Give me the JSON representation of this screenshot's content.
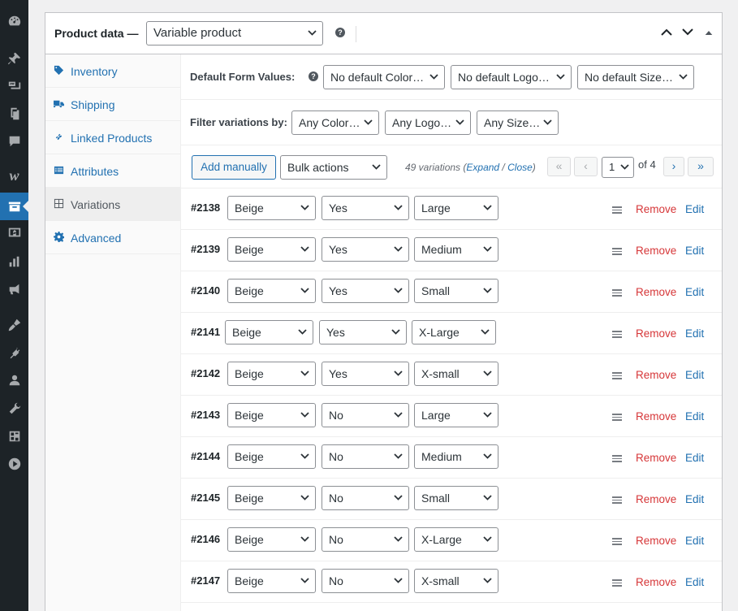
{
  "sidebar_icons": [
    "dashboard-icon",
    "pin-icon",
    "media-icon",
    "pages-icon",
    "comments-icon",
    "woocommerce-icon",
    "products-icon",
    "payments-icon",
    "analytics-icon",
    "marketing-icon",
    "appearance-icon",
    "plugins-icon",
    "users-icon",
    "tools-icon",
    "settings-icon",
    "collapse-icon"
  ],
  "header": {
    "title": "Product data —",
    "product_type": "Variable product",
    "help": "?"
  },
  "tabs": [
    {
      "label": "Inventory",
      "icon": "tag-icon"
    },
    {
      "label": "Shipping",
      "icon": "truck-icon"
    },
    {
      "label": "Linked Products",
      "icon": "link-icon"
    },
    {
      "label": "Attributes",
      "icon": "list-icon"
    },
    {
      "label": "Variations",
      "icon": "grid-icon",
      "active": true
    },
    {
      "label": "Advanced",
      "icon": "gear-icon"
    }
  ],
  "defaults": {
    "label": "Default Form Values:",
    "help": "?",
    "color": "No default Color…",
    "logo": "No default Logo…",
    "size": "No default Size…"
  },
  "filter": {
    "label": "Filter variations by:",
    "color": "Any Color…",
    "logo": "Any Logo…",
    "size": "Any Size…"
  },
  "toolbar": {
    "add_label": "Add manually",
    "bulk_label": "Bulk actions",
    "count_prefix": "49 variations",
    "count_open": "(",
    "expand": "Expand",
    "slash": " / ",
    "close": "Close",
    "count_close": ")",
    "first": "«",
    "prev": "‹",
    "page": "1",
    "of_pages": "of 4",
    "next": "›",
    "last": "»"
  },
  "actions": {
    "remove": "Remove",
    "edit": "Edit"
  },
  "variations": [
    {
      "id": "#2138",
      "color": "Beige",
      "logo": "Yes",
      "size": "Large"
    },
    {
      "id": "#2139",
      "color": "Beige",
      "logo": "Yes",
      "size": "Medium"
    },
    {
      "id": "#2140",
      "color": "Beige",
      "logo": "Yes",
      "size": "Small"
    },
    {
      "id": "#2141",
      "color": "Beige",
      "logo": "Yes",
      "size": "X-Large"
    },
    {
      "id": "#2142",
      "color": "Beige",
      "logo": "Yes",
      "size": "X-small"
    },
    {
      "id": "#2143",
      "color": "Beige",
      "logo": "No",
      "size": "Large"
    },
    {
      "id": "#2144",
      "color": "Beige",
      "logo": "No",
      "size": "Medium"
    },
    {
      "id": "#2145",
      "color": "Beige",
      "logo": "No",
      "size": "Small"
    },
    {
      "id": "#2146",
      "color": "Beige",
      "logo": "No",
      "size": "X-Large"
    },
    {
      "id": "#2147",
      "color": "Beige",
      "logo": "No",
      "size": "X-small"
    }
  ],
  "colors": {
    "accent": "#2271b1",
    "danger": "#d63638",
    "sidebar": "#1d2327"
  }
}
